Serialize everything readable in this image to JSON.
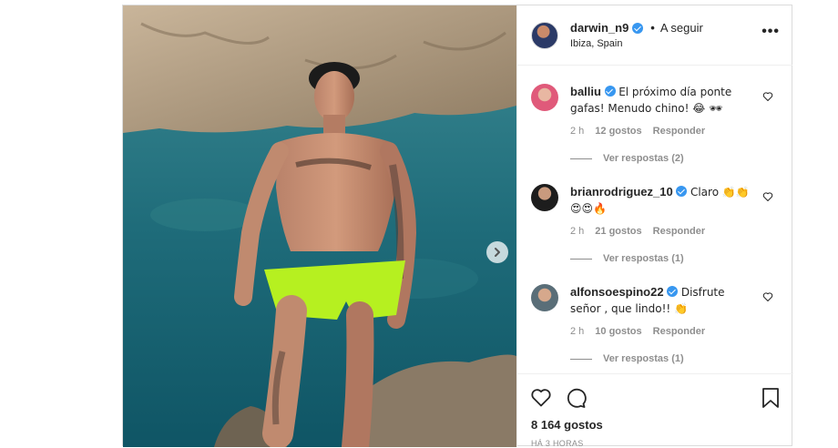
{
  "post": {
    "author": "darwin_n9",
    "follow_label": "A seguir",
    "location": "Ibiza, Spain",
    "more_label": "•••",
    "comments": [
      {
        "user": "balliu",
        "text": "El próximo día ponte gafas! Menudo chino! 😂 🕶",
        "time": "2 h",
        "likes": "12 gostos",
        "reply": "Responder",
        "view_replies": "Ver respostas (2)"
      },
      {
        "user": "brianrodriguez_10",
        "text": "Claro 👏👏 😍😍🔥",
        "time": "2 h",
        "likes": "21 gostos",
        "reply": "Responder",
        "view_replies": "Ver respostas (1)"
      },
      {
        "user": "alfonsoespino22",
        "text": "Disfrute señor , que lindo!! 👏",
        "time": "2 h",
        "likes": "10 gostos",
        "reply": "Responder",
        "view_replies": "Ver respostas (1)"
      }
    ],
    "likes_count": "8 164 gostos",
    "posted_when": "HÁ 3 HORAS"
  },
  "icons": {
    "verified": "verified-badge-icon",
    "heart": "heart-icon",
    "comment": "comment-icon",
    "bookmark": "bookmark-icon",
    "next": "chevron-right-icon",
    "more": "more-options-icon"
  }
}
